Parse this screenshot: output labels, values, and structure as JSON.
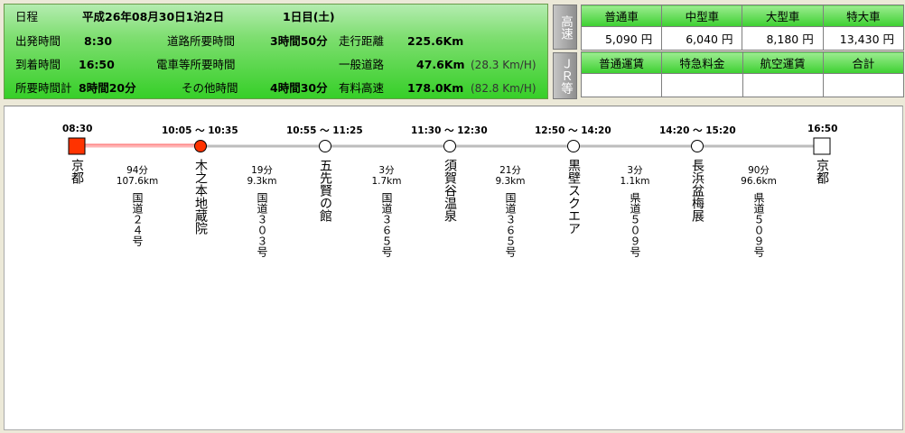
{
  "summary": {
    "schedule_label": "日程",
    "schedule_value": "平成26年08月30日1泊2日",
    "day_label": "1日目(土)",
    "depart_label": "出発時間",
    "depart_value": "8:30",
    "arrive_label": "到着時間",
    "arrive_value": "16:50",
    "total_time_label": "所要時間計",
    "total_time_value": "8時間20分",
    "road_time_label": "道路所要時間",
    "road_time_value": "3時間50分",
    "train_time_label": "電車等所要時間",
    "train_time_value": "",
    "other_time_label": "その他時間",
    "other_time_value": "4時間30分",
    "distance_label": "走行距離",
    "distance_value": "225.6Km",
    "general_label": "一般道路",
    "general_value": "47.6Km",
    "general_speed": "(28.3 Km/H)",
    "toll_label": "有料高速",
    "toll_value": "178.0Km",
    "toll_speed": "(82.8 Km/H)"
  },
  "side_buttons": {
    "expressway": "高速",
    "jr": "ＪＲ等"
  },
  "toll_table": {
    "headers": [
      "普通車",
      "中型車",
      "大型車",
      "特大車"
    ],
    "values": [
      "5,090 円",
      "6,040 円",
      "8,180 円",
      "13,430 円"
    ]
  },
  "fare_table": {
    "headers": [
      "普通運賃",
      "特急料金",
      "航空運賃",
      "合計"
    ],
    "values": [
      "",
      "",
      "",
      ""
    ]
  },
  "route": {
    "stops": [
      {
        "time": "08:30",
        "name": "京都"
      },
      {
        "time": "10:05 〜 10:35",
        "name": "木之本地蔵院"
      },
      {
        "time": "10:55 〜 11:25",
        "name": "五先賢の館"
      },
      {
        "time": "11:30 〜 12:30",
        "name": "須賀谷温泉"
      },
      {
        "time": "12:50 〜 14:20",
        "name": "黒壁スクエア"
      },
      {
        "time": "14:20 〜 15:20",
        "name": "長浜盆梅展"
      },
      {
        "time": "16:50",
        "name": "京都"
      }
    ],
    "segments": [
      {
        "duration": "94分",
        "distance": "107.6km",
        "road": "国道２４号"
      },
      {
        "duration": "19分",
        "distance": "9.3km",
        "road": "国道３０３号"
      },
      {
        "duration": "3分",
        "distance": "1.7km",
        "road": "国道３６５号"
      },
      {
        "duration": "21分",
        "distance": "9.3km",
        "road": "国道３６５号"
      },
      {
        "duration": "3分",
        "distance": "1.1km",
        "road": "県道５０９号"
      },
      {
        "duration": "90分",
        "distance": "96.6km",
        "road": "県道５０９号"
      }
    ],
    "colors": {
      "start": "#ff3300",
      "current": "#ff3300",
      "line": "#c0c0c0",
      "progress": "#ffb0b0"
    }
  }
}
